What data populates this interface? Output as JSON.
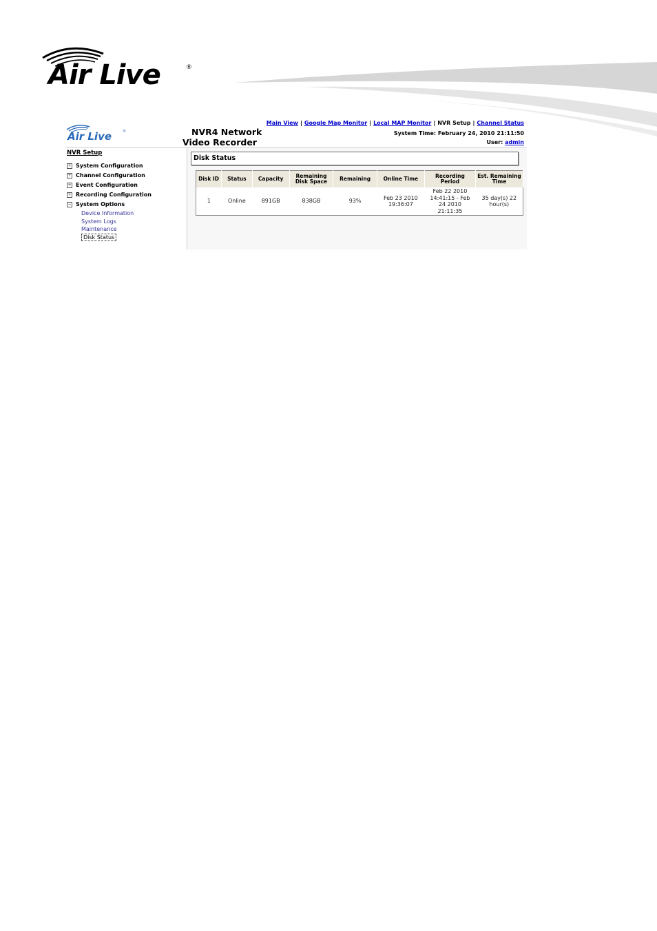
{
  "logo": {
    "brand_text": "Air Live",
    "registered_mark": "®"
  },
  "app": {
    "title_line1": "NVR4 Network",
    "title_line2": "Video Recorder"
  },
  "nav": {
    "items": [
      {
        "label": "Main View",
        "link": true
      },
      {
        "label": "Google Map Monitor",
        "link": true
      },
      {
        "label": "Local MAP Monitor",
        "link": true
      },
      {
        "label": "NVR Setup",
        "link": false
      },
      {
        "label": "Channel Status",
        "link": true
      }
    ],
    "separator": "|"
  },
  "system_time": "System Time: February 24, 2010 21:11:50",
  "user": {
    "label": "User:",
    "name": "admin"
  },
  "sidebar": {
    "title": "NVR Setup",
    "groups": [
      {
        "label": "System Configuration",
        "expanded": false,
        "toggle": "+"
      },
      {
        "label": "Channel Configuration",
        "expanded": false,
        "toggle": "+"
      },
      {
        "label": "Event Configuration",
        "expanded": false,
        "toggle": "+"
      },
      {
        "label": "Recording Configuration",
        "expanded": false,
        "toggle": "+"
      },
      {
        "label": "System Options",
        "expanded": true,
        "toggle": "−"
      }
    ],
    "sub_items": [
      {
        "label": "Device Information"
      },
      {
        "label": "System Logs"
      },
      {
        "label": "Maintenance"
      },
      {
        "label": "Disk Status",
        "active": true
      }
    ]
  },
  "content": {
    "section_title": "Disk Status",
    "table": {
      "headers": [
        "Disk ID",
        "Status",
        "Capacity",
        "Remaining Disk Space",
        "Remaining",
        "Online Time",
        "Recording Period",
        "Est. Remaining Time"
      ],
      "rows": [
        [
          "1",
          "Online",
          "891GB",
          "838GB",
          "93%",
          "Feb 23 2010 19:36:07",
          "Feb 22 2010 14:41:15 - Feb 24 2010 21:11:35",
          "35 day(s) 22 hour(s)"
        ]
      ]
    }
  },
  "colors": {
    "link": "#0000cc",
    "brand_blue": "#2a6ab8",
    "table_header": "#ece8dc"
  }
}
